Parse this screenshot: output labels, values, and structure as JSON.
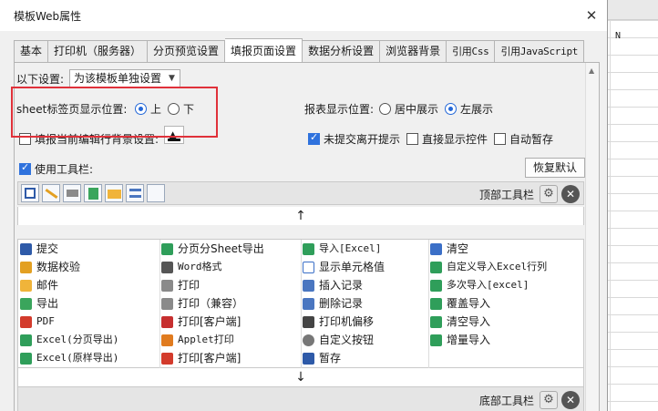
{
  "background_sheet": {
    "column_label": "N"
  },
  "dialog": {
    "title": "模板Web属性",
    "close_glyph": "✕"
  },
  "tabs": [
    {
      "label": "基本"
    },
    {
      "label": "打印机（服务器）"
    },
    {
      "label": "分页预览设置"
    },
    {
      "label": "填报页面设置",
      "active": true
    },
    {
      "label": "数据分析设置"
    },
    {
      "label": "浏览器背景"
    },
    {
      "label": "引用Css"
    },
    {
      "label": "引用JavaScript"
    }
  ],
  "settings": {
    "scope_label": "以下设置:",
    "scope_value": "为该模板单独设置",
    "sheet_tab_label": "sheet标签页显示位置:",
    "sheet_tab_options": [
      {
        "label": "上",
        "selected": true
      },
      {
        "label": "下",
        "selected": false
      }
    ],
    "report_position_label": "报表显示位置:",
    "report_position_options": [
      {
        "label": "居中展示",
        "selected": false
      },
      {
        "label": "左展示",
        "selected": true
      }
    ],
    "highlight_row_label": "填报当前编辑行背景设置:",
    "highlight_row_checked": false,
    "unsubmitted_prompt_label": "未提交离开提示",
    "unsubmitted_prompt_checked": true,
    "direct_show_widget_label": "直接显示控件",
    "direct_show_widget_checked": false,
    "auto_save_label": "自动暂存",
    "auto_save_checked": false,
    "use_toolbar_label": "使用工具栏:",
    "use_toolbar_checked": true,
    "restore_default_label": "恢复默认"
  },
  "top_toolbar": {
    "label": "顶部工具栏"
  },
  "bottom_toolbar": {
    "label": "底部工具栏"
  },
  "arrows": {
    "up": "↑",
    "down": "↓"
  },
  "colors": {
    "highlight_border": "#e0313a",
    "accent": "#2468d8"
  },
  "toolbar_items": [
    [
      "提交",
      "分页分Sheet导出",
      "导入[Excel]",
      "清空"
    ],
    [
      "数据校验",
      "Word格式",
      "显示单元格值",
      "自定义导入Excel行列"
    ],
    [
      "邮件",
      "打印",
      "插入记录",
      "多次导入[excel]"
    ],
    [
      "导出",
      "打印（兼容）",
      "删除记录",
      "覆盖导入"
    ],
    [
      "PDF",
      "打印[客户端]",
      "打印机偏移",
      "清空导入"
    ],
    [
      "Excel(分页导出)",
      "Applet打印",
      "自定义按钮",
      "增量导入"
    ],
    [
      "Excel(原样导出)",
      "打印[客户端]",
      "暂存",
      ""
    ]
  ]
}
